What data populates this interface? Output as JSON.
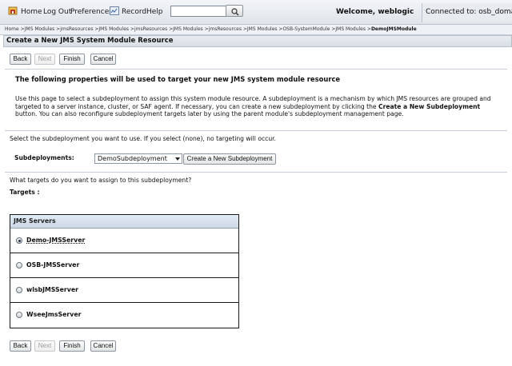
{
  "topbar": {
    "home": "Home",
    "logout": "Log Out",
    "preferences": "Preferences",
    "record": "Record",
    "help": "Help",
    "search_value": "",
    "welcome": "Welcome, weblogic",
    "connected": "Connected to:  osb_domain"
  },
  "breadcrumb": {
    "path": "Home >JMS Modules >jmsResources >JMS Modules >jmsResources >JMS Modules >jmsResources >JMS Modules >OSB-SystemModule >JMS Modules >",
    "current": "DemoJMSModule"
  },
  "page": {
    "title": "Create a New JMS System Module Resource",
    "intro_heading": "The following properties will be used to target your new JMS system module resource",
    "desc_part1": "Use this page to select a subdeployment to assign this system module resource. A subdeployment is a mechanism by which JMS resources are grouped and targeted to a server instance, cluster, or SAF agent. If necessary, you can create a new subdeployment by clicking the ",
    "desc_bold": "Create a New Subdeployment",
    "desc_part2": " button. You can also reconfigure subdeployment targets later by using the parent module's subdeployment management page.",
    "select_hint": "Select the subdeployment you want to use. If you select (none), no targeting will occur.",
    "subdeployments_label": "Subdeployments:",
    "subdeployment_value": "DemoSubdeployment",
    "create_button": "Create a New Subdeployment",
    "targets_question": "What targets do you want to assign to this subdeployment?",
    "targets_label": "Targets :"
  },
  "buttons": {
    "back": "Back",
    "next": "Next",
    "finish": "Finish",
    "cancel": "Cancel"
  },
  "table": {
    "header": "JMS Servers",
    "rows": [
      {
        "label": "Demo-JMSServer",
        "checked": true
      },
      {
        "label": "OSB-JMSServer",
        "checked": false
      },
      {
        "label": "wlsbJMSServer",
        "checked": false
      },
      {
        "label": "WseeJmsServer",
        "checked": false
      }
    ]
  },
  "icons": {
    "home": "home-icon",
    "record": "record-icon",
    "search": "search-icon",
    "dropdown": "chevron-down-icon"
  },
  "colors": {
    "topbar": "#dfe4ea",
    "table_header": "#cdd8e5",
    "border": "#1a1a1a"
  }
}
